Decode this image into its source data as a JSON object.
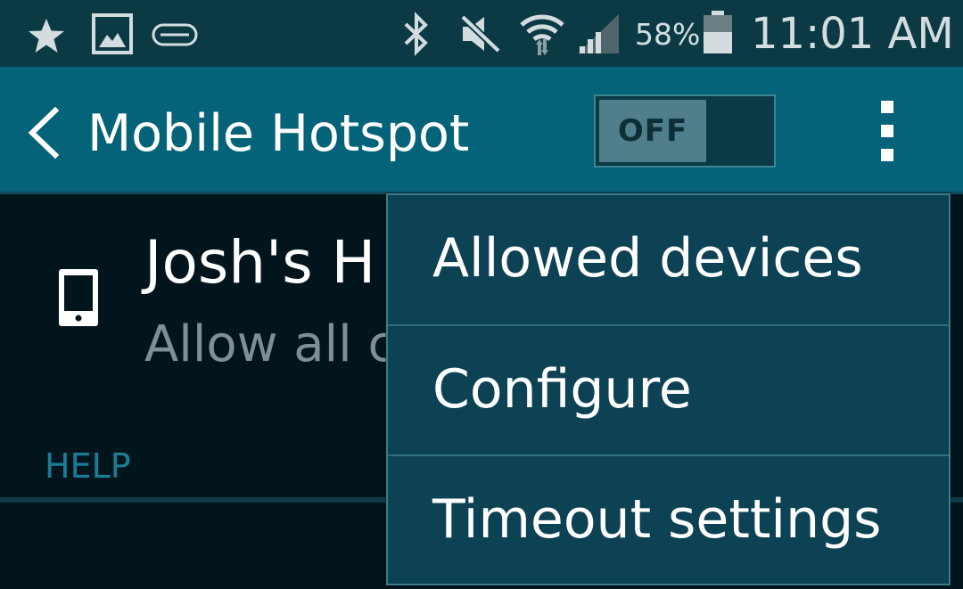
{
  "status_bar": {
    "icons": [
      "star-icon",
      "gallery-icon",
      "gear-fit-icon",
      "bluetooth-icon",
      "mute-icon",
      "wifi-icon",
      "signal-icon",
      "battery-icon"
    ],
    "battery_percent": "58%",
    "time": "11:01 AM"
  },
  "action_bar": {
    "back_icon": "chevron-left-icon",
    "title": "Mobile Hotspot",
    "toggle_label": "OFF",
    "overflow_icon": "more-vert-icon"
  },
  "content": {
    "hotspot_name": "Josh's H",
    "hotspot_subtitle": "Allow all c",
    "help_label": "HELP"
  },
  "overflow_menu": {
    "items": [
      {
        "label": "Allowed devices"
      },
      {
        "label": "Configure"
      },
      {
        "label": "Timeout settings"
      }
    ]
  },
  "colors": {
    "status_bar_bg": "#0c3a44",
    "action_bar_bg": "#046378",
    "content_bg": "#03151c",
    "menu_bg": "#0c4253",
    "help_accent": "#1a7d97"
  }
}
